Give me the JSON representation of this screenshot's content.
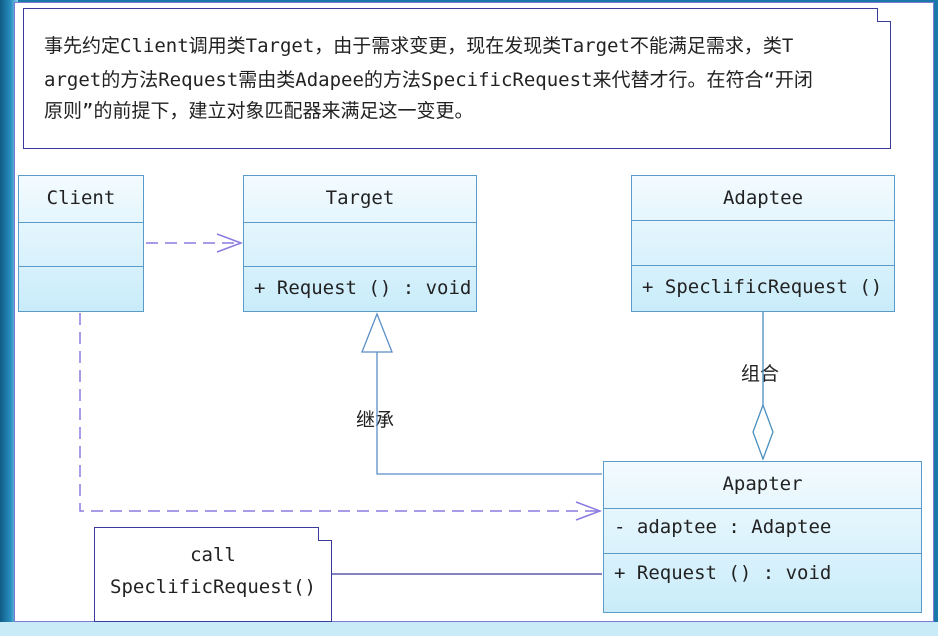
{
  "note_top": {
    "line1": "事先约定Client调用类Target，由于需求变更，现在发现类Target不能满足需求，类T",
    "line2": "arget的方法Request需由类Adapee的方法SpecificRequest来代替才行。在符合“开闭",
    "line3": "原则”的前提下，建立对象匹配器来满足这一变更。"
  },
  "classes": {
    "client": {
      "name": "Client"
    },
    "target": {
      "name": "Target",
      "op": "+ Request () : void"
    },
    "adaptee": {
      "name": "Adaptee",
      "op": "+ SpeclificRequest ()"
    },
    "apapter": {
      "name": "Apapter",
      "attr": "- adaptee : Adaptee",
      "op": "+ Request () : void"
    }
  },
  "labels": {
    "inherit": "继承",
    "compose": "组合"
  },
  "note_call": {
    "line1": "call",
    "line2": "SpeclificRequest()"
  },
  "colors": {
    "dependency": "#8a7be0",
    "solid": "#4a8fc0",
    "border": "#5a9bc9"
  }
}
